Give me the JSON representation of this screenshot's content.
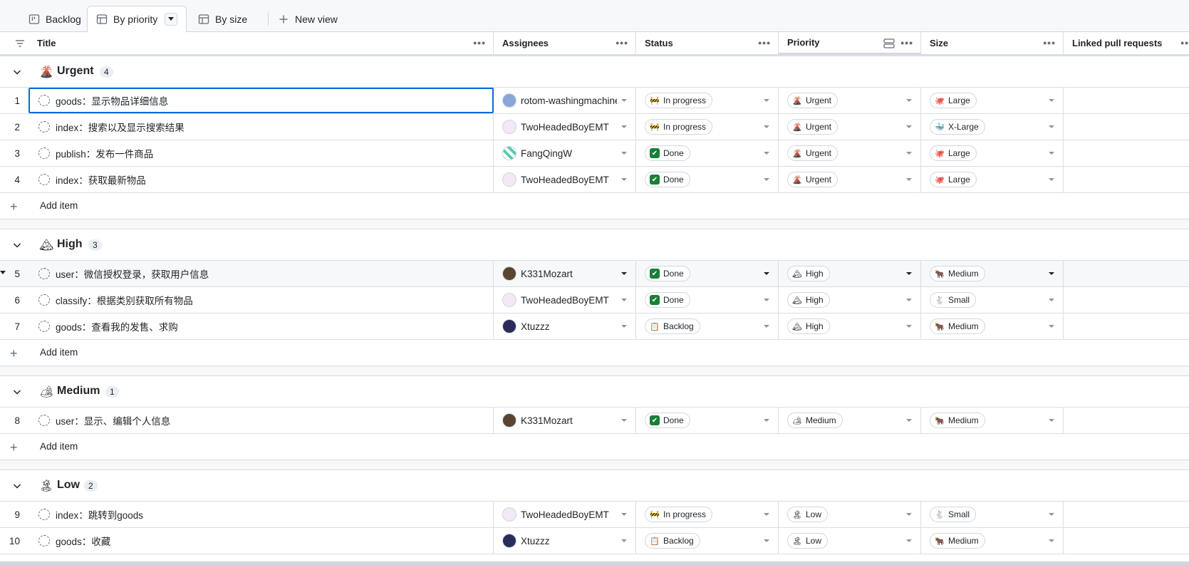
{
  "tabs": [
    {
      "label": "Backlog",
      "icon": "board-icon"
    },
    {
      "label": "By priority",
      "icon": "table-icon",
      "active": true
    },
    {
      "label": "By size",
      "icon": "table-icon"
    }
  ],
  "new_view_label": "New view",
  "columns": {
    "title": "Title",
    "assignees": "Assignees",
    "status": "Status",
    "priority": "Priority",
    "size": "Size",
    "linked": "Linked pull requests"
  },
  "add_item_label": "Add item",
  "groups": [
    {
      "name": "Urgent",
      "icon": "🌋",
      "count": "4",
      "rows": [
        {
          "num": "1",
          "title": "goods：显示物品详细信息",
          "assignee": "rotom-washingmachine",
          "avatar": "a-rotom",
          "status": "In progress",
          "status_icon": "🚧",
          "priority": "Urgent",
          "priority_icon": "🌋",
          "size": "Large",
          "size_icon": "🐙"
        },
        {
          "num": "2",
          "title": "index：搜索以及显示搜索结果",
          "assignee": "TwoHeadedBoyEMT",
          "avatar": "a-two",
          "status": "In progress",
          "status_icon": "🚧",
          "priority": "Urgent",
          "priority_icon": "🌋",
          "size": "X-Large",
          "size_icon": "🐳"
        },
        {
          "num": "3",
          "title": "publish：发布一件商品",
          "assignee": "FangQingW",
          "avatar": "a-fang",
          "status": "Done",
          "status_icon": "✔",
          "priority": "Urgent",
          "priority_icon": "🌋",
          "size": "Large",
          "size_icon": "🐙"
        },
        {
          "num": "4",
          "title": "index：获取最新物品",
          "assignee": "TwoHeadedBoyEMT",
          "avatar": "a-two",
          "status": "Done",
          "status_icon": "✔",
          "priority": "Urgent",
          "priority_icon": "🌋",
          "size": "Large",
          "size_icon": "🐙"
        }
      ]
    },
    {
      "name": "High",
      "icon": "🏔",
      "count": "3",
      "rows": [
        {
          "num": "5",
          "title": "user：微信授权登录，获取用户信息",
          "assignee": "K331Mozart",
          "avatar": "a-k33",
          "status": "Done",
          "status_icon": "✔",
          "priority": "High",
          "priority_icon": "🏔",
          "size": "Medium",
          "size_icon": "🐂"
        },
        {
          "num": "6",
          "title": "classify：根据类别获取所有物品",
          "assignee": "TwoHeadedBoyEMT",
          "avatar": "a-two",
          "status": "Done",
          "status_icon": "✔",
          "priority": "High",
          "priority_icon": "🏔",
          "size": "Small",
          "size_icon": "🐇"
        },
        {
          "num": "7",
          "title": "goods：查看我的发售、求购",
          "assignee": "Xtuzzz",
          "avatar": "a-xtu",
          "status": "Backlog",
          "status_icon": "📋",
          "priority": "High",
          "priority_icon": "🏔",
          "size": "Medium",
          "size_icon": "🐂"
        }
      ]
    },
    {
      "name": "Medium",
      "icon": "🏕",
      "count": "1",
      "rows": [
        {
          "num": "8",
          "title": "user：显示、编辑个人信息",
          "assignee": "K331Mozart",
          "avatar": "a-k33",
          "status": "Done",
          "status_icon": "✔",
          "priority": "Medium",
          "priority_icon": "🏕",
          "size": "Medium",
          "size_icon": "🐂"
        }
      ]
    },
    {
      "name": "Low",
      "icon": "🏝",
      "count": "2",
      "rows": [
        {
          "num": "9",
          "title": "index：跳转到goods",
          "assignee": "TwoHeadedBoyEMT",
          "avatar": "a-two",
          "status": "In progress",
          "status_icon": "🚧",
          "priority": "Low",
          "priority_icon": "🏝",
          "size": "Small",
          "size_icon": "🐇"
        },
        {
          "num": "10",
          "title": "goods：收藏",
          "assignee": "Xtuzzz",
          "avatar": "a-xtu",
          "status": "Backlog",
          "status_icon": "📋",
          "priority": "Low",
          "priority_icon": "🏝",
          "size": "Medium",
          "size_icon": "🐂"
        }
      ]
    }
  ]
}
